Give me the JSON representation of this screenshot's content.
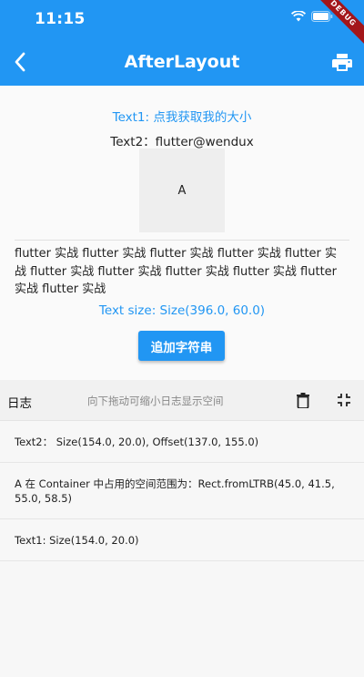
{
  "status_bar": {
    "time": "11:15"
  },
  "debug_banner": "DEBUG",
  "appbar": {
    "title": "AfterLayout"
  },
  "content": {
    "text1": "Text1: 点我获取我的大小",
    "text2": "Text2：flutter@wendux",
    "box_label": "A",
    "paragraph": "flutter 实战 flutter 实战 flutter 实战 flutter 实战 flutter 实战 flutter 实战 flutter 实战 flutter 实战 flutter 实战 flutter 实战 flutter 实战",
    "size_text": "Text size: Size(396.0, 60.0)",
    "add_button": "追加字符串"
  },
  "log": {
    "title": "日志",
    "hint": "向下拖动可缩小日志显示空间",
    "items": [
      "Text2： Size(154.0, 20.0), Offset(137.0, 155.0)",
      "A 在 Container 中占用的空间范围为：Rect.fromLTRB(45.0, 41.5, 55.0, 58.5)",
      "Text1: Size(154.0, 20.0)"
    ]
  },
  "colors": {
    "primary": "#2196f3",
    "debug": "#a3161a"
  }
}
